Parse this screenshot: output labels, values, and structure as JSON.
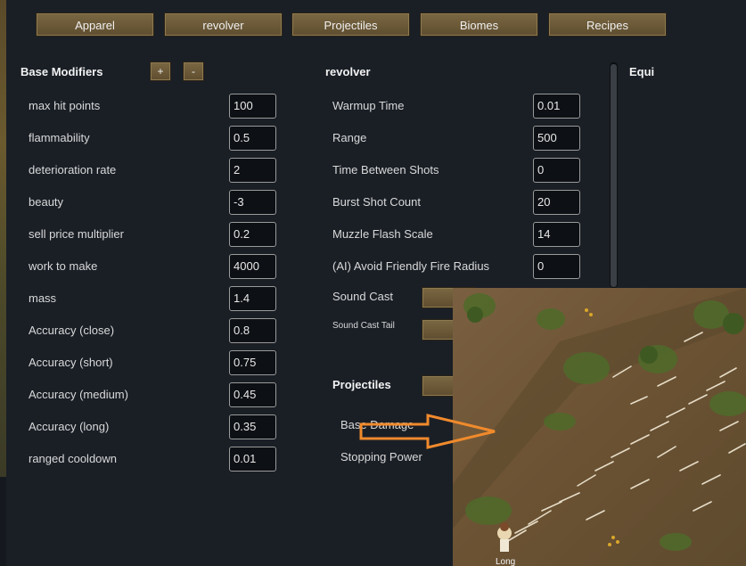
{
  "tabs": [
    {
      "label": "Apparel"
    },
    {
      "label": "revolver"
    },
    {
      "label": "Projectiles"
    },
    {
      "label": "Biomes"
    },
    {
      "label": "Recipes"
    }
  ],
  "base_modifiers": {
    "title": "Base Modifiers",
    "add_label": "+",
    "remove_label": "-",
    "rows": [
      {
        "label": "max hit points",
        "value": "100"
      },
      {
        "label": "flammability",
        "value": "0.5"
      },
      {
        "label": "deterioration rate",
        "value": "2"
      },
      {
        "label": "beauty",
        "value": "-3"
      },
      {
        "label": "sell price multiplier",
        "value": "0.2"
      },
      {
        "label": "work to make",
        "value": "4000"
      },
      {
        "label": "mass",
        "value": "1.4"
      },
      {
        "label": "Accuracy (close)",
        "value": "0.8"
      },
      {
        "label": "Accuracy (short)",
        "value": "0.75"
      },
      {
        "label": "Accuracy (medium)",
        "value": "0.45"
      },
      {
        "label": "Accuracy (long)",
        "value": "0.35"
      },
      {
        "label": "ranged cooldown",
        "value": "0.01"
      }
    ]
  },
  "weapon": {
    "title": "revolver",
    "rows": [
      {
        "label": "Warmup Time",
        "value": "0.01"
      },
      {
        "label": "Range",
        "value": "500"
      },
      {
        "label": "Time Between Shots",
        "value": "0"
      },
      {
        "label": "Burst Shot Count",
        "value": "20"
      },
      {
        "label": "Muzzle Flash Scale",
        "value": "14"
      },
      {
        "label": "(AI) Avoid Friendly Fire Radius",
        "value": "0"
      }
    ],
    "sound_cast_label": "Sound Cast",
    "sound_cast_tail_label": "Sound Cast Tail"
  },
  "projectiles": {
    "title": "Projectiles",
    "base_damage_label": "Base Damage",
    "stopping_power_label": "Stopping Power"
  },
  "equip_title": "Equi",
  "overlay": {
    "pawn_name": "Long",
    "arrow_color": "#f08a2c"
  }
}
